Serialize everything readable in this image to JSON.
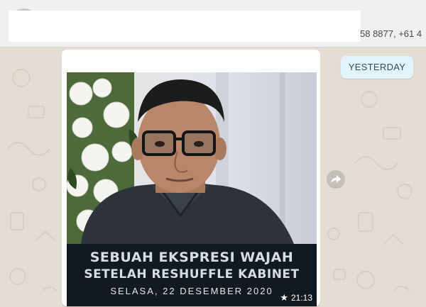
{
  "chat_header": {
    "participants": "58 8877, +61 4"
  },
  "date_divider": {
    "label": "YESTERDAY"
  },
  "message": {
    "caption_line1": "SEBUAH EKSPRESI WAJAH",
    "caption_line2": "SETELAH RESHUFFLE KABINET",
    "caption_date": "SELASA, 22 DESEMBER 2020",
    "time": "21:13",
    "starred": true
  },
  "icons": {
    "star": "star-icon",
    "forward": "forward-icon"
  },
  "colors": {
    "wallpaper": "#e4ddd3",
    "date_chip": "#e1f3fb",
    "caption_bar": "#111a20"
  }
}
